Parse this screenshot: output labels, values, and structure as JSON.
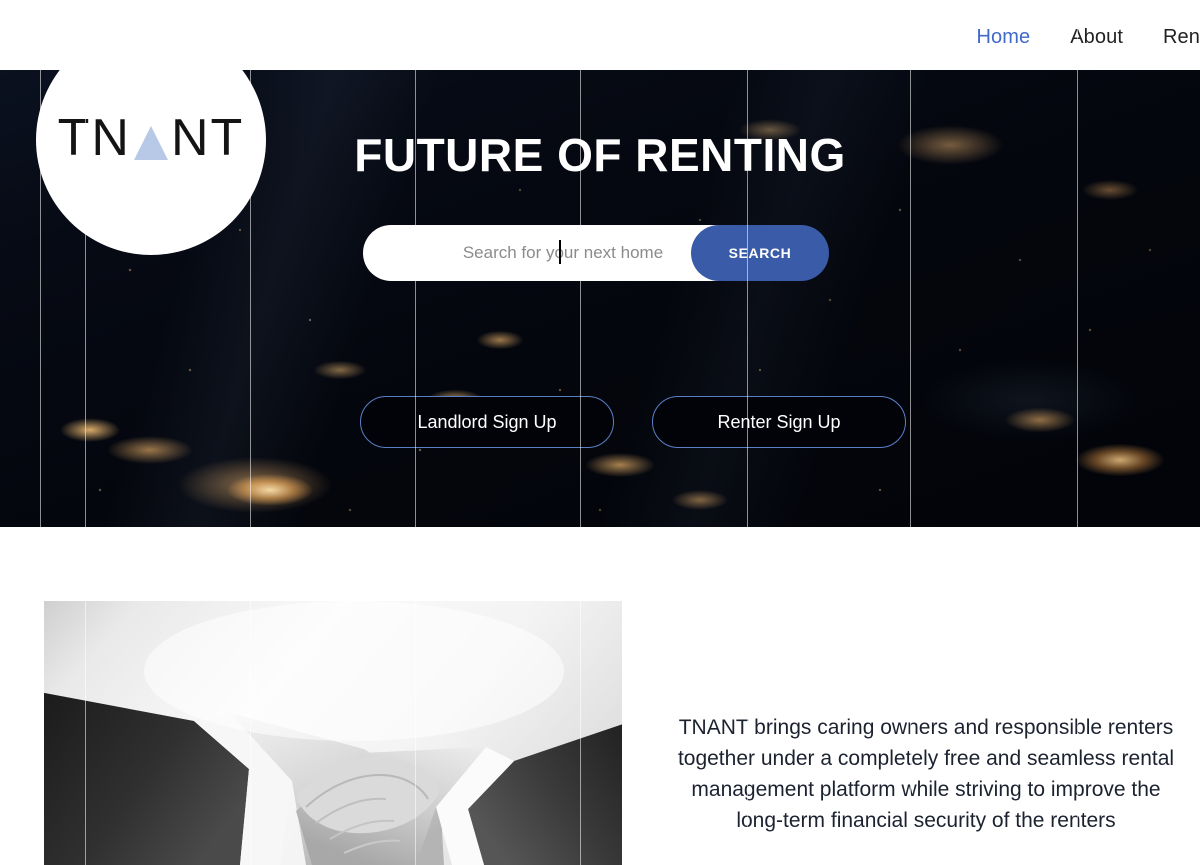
{
  "nav": {
    "links": [
      {
        "label": "Home",
        "active": true
      },
      {
        "label": "About",
        "active": false
      },
      {
        "label": "Ren",
        "active": false
      }
    ]
  },
  "logo": {
    "text_before": "TN",
    "text_after": "NT",
    "icon": "triangle-icon",
    "triangle_color": "#b8c9e8"
  },
  "hero": {
    "title": "FUTURE OF RENTING",
    "background_description": "earth-at-night-from-space",
    "search": {
      "placeholder": "Search for your next home",
      "value": "",
      "button_label": "SEARCH",
      "button_color": "#3a5ba8"
    },
    "signup": {
      "landlord_label": "Landlord Sign Up",
      "renter_label": "Renter Sign Up",
      "border_color": "#5b7fc7"
    }
  },
  "about": {
    "image_description": "grayscale-handshake-photo",
    "paragraph": "TNANT brings caring owners and responsible renters together under a completely free and seamless rental management platform while striving to improve the long-term financial security of the renters"
  },
  "grid": {
    "line_positions": [
      40,
      85,
      250,
      415,
      580,
      747,
      910,
      1077
    ],
    "line_color": "#ffffff"
  },
  "colors": {
    "accent_blue": "#4169c8",
    "button_blue": "#3a5ba8",
    "logo_triangle": "#b8c9e8",
    "text_dark": "#1c2230"
  }
}
